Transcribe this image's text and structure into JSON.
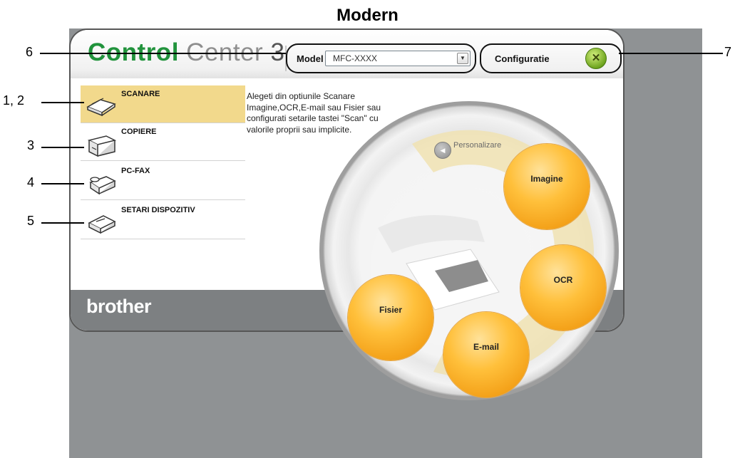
{
  "page_heading": "Modern",
  "app": {
    "logo_control": "Control",
    "logo_center": " Center",
    "logo_number": "3",
    "brand": "brother"
  },
  "model": {
    "label": "Model",
    "value": "MFC-XXXX"
  },
  "config": {
    "label": "Configuratie"
  },
  "sidebar": {
    "items": [
      {
        "label": "SCANARE",
        "active": true
      },
      {
        "label": "COPIERE",
        "active": false
      },
      {
        "label": "PC-FAX",
        "active": false
      },
      {
        "label": "SETARI DISPOZITIV",
        "active": false
      }
    ]
  },
  "main": {
    "description": "Alegeti din optiunile Scanare Imagine,OCR,E-mail sau Fisier sau configurati setarile  tastei \"Scan\" cu valorile proprii sau implicite.",
    "personalize_label": "Personalizare",
    "buttons": {
      "image": "Imagine",
      "ocr": "OCR",
      "email": "E-mail",
      "file": "Fisier"
    }
  },
  "callouts": {
    "model": "6",
    "config": "7",
    "scan": "1, 2",
    "copy": "3",
    "pcfax": "4",
    "device_settings": "5"
  },
  "colors": {
    "brand_green": "#21933c",
    "active_tab": "#f2d98c",
    "bubble_orange": "#f4a21a",
    "backdrop_gray": "#8f9294"
  }
}
